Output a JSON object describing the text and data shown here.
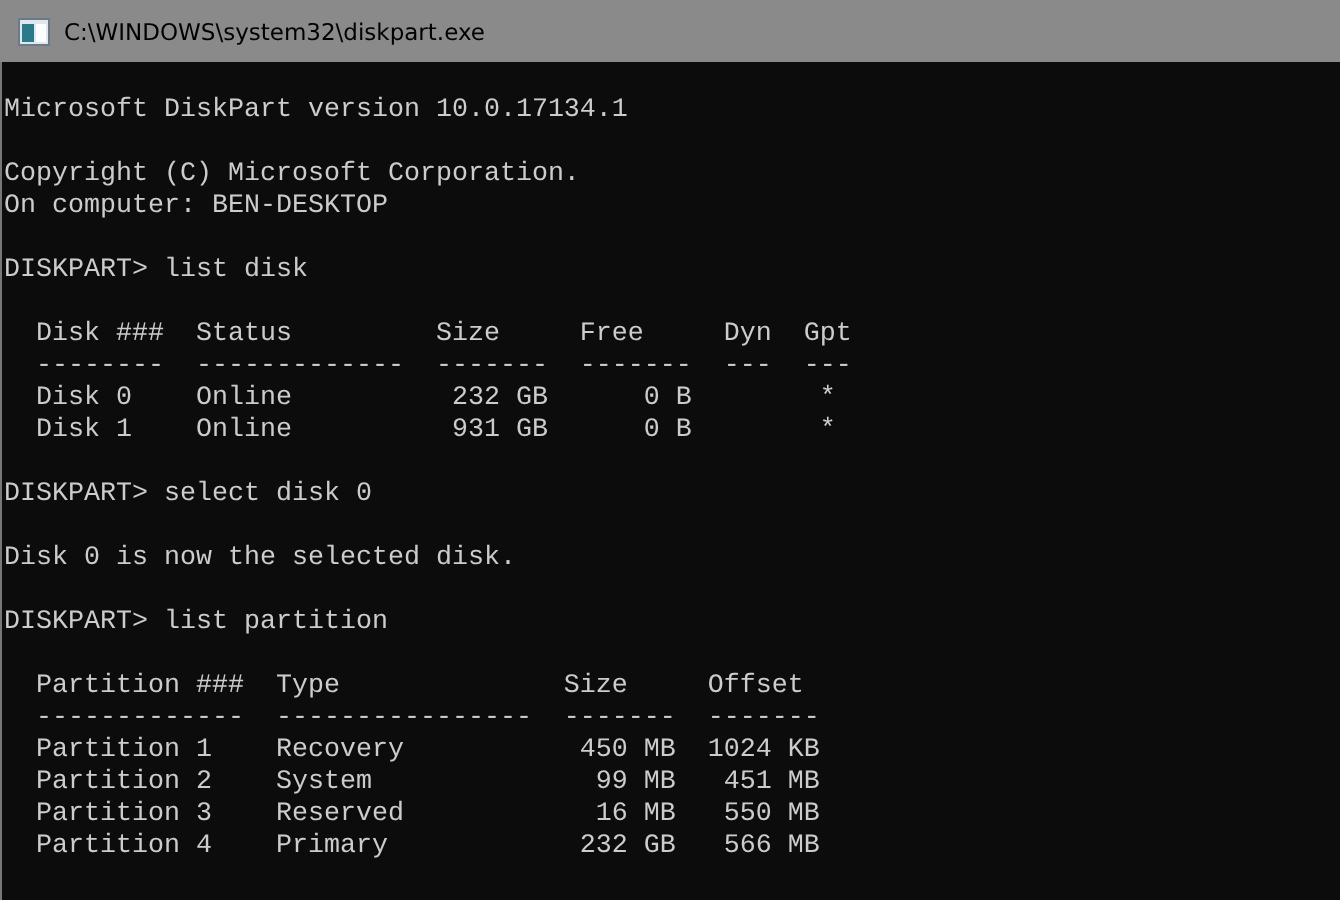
{
  "window": {
    "title": "C:\\WINDOWS\\system32\\diskpart.exe"
  },
  "console": {
    "lines": [
      {
        "kind": "blank"
      },
      {
        "kind": "text",
        "text": "Microsoft DiskPart version 10.0.17134.1"
      },
      {
        "kind": "blank"
      },
      {
        "kind": "text",
        "text": "Copyright (C) Microsoft Corporation."
      },
      {
        "kind": "text",
        "text": "On computer: BEN-DESKTOP"
      },
      {
        "kind": "blank"
      },
      {
        "kind": "text",
        "text": "DISKPART> list disk"
      },
      {
        "kind": "blank"
      },
      {
        "kind": "text",
        "text": "  Disk ###  Status         Size     Free     Dyn  Gpt"
      },
      {
        "kind": "text",
        "text": "  --------  -------------  -------  -------  ---  ---"
      },
      {
        "kind": "text",
        "text": "  Disk 0    Online          232 GB      0 B        *"
      },
      {
        "kind": "text",
        "text": "  Disk 1    Online          931 GB      0 B        *"
      },
      {
        "kind": "blank"
      },
      {
        "kind": "text",
        "text": "DISKPART> select disk 0"
      },
      {
        "kind": "blank"
      },
      {
        "kind": "text",
        "text": "Disk 0 is now the selected disk."
      },
      {
        "kind": "blank"
      },
      {
        "kind": "text",
        "text": "DISKPART> list partition"
      },
      {
        "kind": "blank"
      },
      {
        "kind": "text",
        "text": "  Partition ###  Type              Size     Offset"
      },
      {
        "kind": "text",
        "text": "  -------------  ----------------  -------  -------"
      },
      {
        "kind": "text",
        "text": "  Partition 1    Recovery           450 MB  1024 KB"
      },
      {
        "kind": "text",
        "text": "  Partition 2    System              99 MB   451 MB"
      },
      {
        "kind": "text",
        "text": "  Partition 3    Reserved            16 MB   550 MB"
      },
      {
        "kind": "text",
        "text": "  Partition 4    Primary            232 GB   566 MB"
      }
    ]
  }
}
